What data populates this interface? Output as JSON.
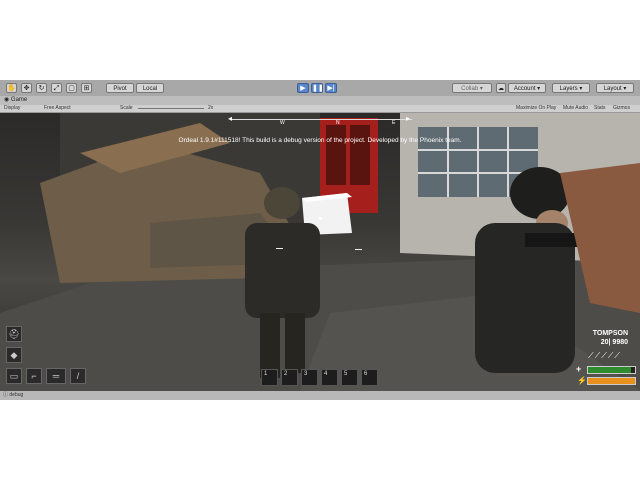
{
  "toolbar": {
    "pivot": "Pivot",
    "local": "Local",
    "collab": "Collab",
    "account": "Account",
    "layers": "Layers",
    "layout": "Layout",
    "play_icon": "play-icon",
    "pause_icon": "pause-icon",
    "step_icon": "step-icon"
  },
  "panel": {
    "tab_title": "Game",
    "display": "Display",
    "aspect": "Free Aspect",
    "scale_label": "Scale",
    "scale_value": "2x",
    "maximize": "Maximize On Play",
    "mute": "Mute Audio",
    "stats": "Stats",
    "gizmos": "Gizmos"
  },
  "hud": {
    "debug_text": "Ordeal 1.9.1#111518! This build is a debug version of the project. Developed by the Phoenix team.",
    "compass_labels": [
      "W",
      "N",
      "E"
    ],
    "weapon_name": "TOMPSON",
    "ammo": "20| 9980",
    "health_fraction": 0.92,
    "stamina_fraction": 1.0,
    "health_color": "#2e8b2e",
    "stamina_color": "#e8901c",
    "hotbar": [
      "1",
      "2",
      "3",
      "4",
      "5",
      "6"
    ],
    "equipment_icons": [
      "helmet-icon",
      "vest-icon",
      "bag-icon",
      "pistol-icon",
      "rifle-icon",
      "knife-icon"
    ]
  },
  "status": {
    "message": "debug"
  }
}
